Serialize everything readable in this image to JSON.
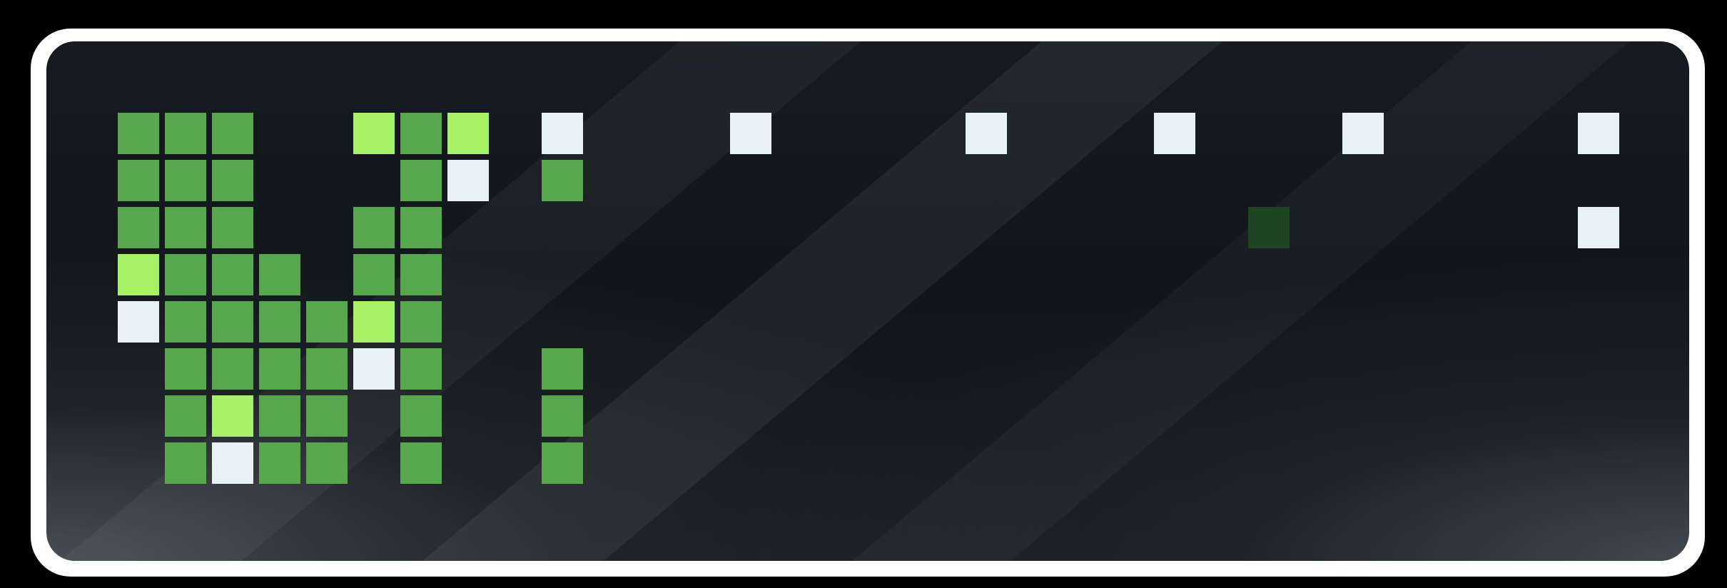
{
  "grid": {
    "columns": 32,
    "rows": 8,
    "colors": {
      "green": "#57a84c",
      "lime": "#a6f264",
      "white": "#e8f1f4",
      "dark_green": "#1f4422"
    },
    "cells": [
      {
        "c": 0,
        "r": 0,
        "t": "green"
      },
      {
        "c": 1,
        "r": 0,
        "t": "green"
      },
      {
        "c": 2,
        "r": 0,
        "t": "green"
      },
      {
        "c": 5,
        "r": 0,
        "t": "lime"
      },
      {
        "c": 6,
        "r": 0,
        "t": "green"
      },
      {
        "c": 7,
        "r": 0,
        "t": "lime"
      },
      {
        "c": 9,
        "r": 0,
        "t": "white"
      },
      {
        "c": 13,
        "r": 0,
        "t": "white"
      },
      {
        "c": 18,
        "r": 0,
        "t": "white"
      },
      {
        "c": 22,
        "r": 0,
        "t": "white"
      },
      {
        "c": 26,
        "r": 0,
        "t": "white"
      },
      {
        "c": 31,
        "r": 0,
        "t": "white"
      },
      {
        "c": 0,
        "r": 1,
        "t": "green"
      },
      {
        "c": 1,
        "r": 1,
        "t": "green"
      },
      {
        "c": 2,
        "r": 1,
        "t": "green"
      },
      {
        "c": 6,
        "r": 1,
        "t": "green"
      },
      {
        "c": 7,
        "r": 1,
        "t": "white"
      },
      {
        "c": 9,
        "r": 1,
        "t": "green"
      },
      {
        "c": 0,
        "r": 2,
        "t": "green"
      },
      {
        "c": 1,
        "r": 2,
        "t": "green"
      },
      {
        "c": 2,
        "r": 2,
        "t": "green"
      },
      {
        "c": 5,
        "r": 2,
        "t": "green"
      },
      {
        "c": 6,
        "r": 2,
        "t": "green"
      },
      {
        "c": 24,
        "r": 2,
        "t": "dark_green"
      },
      {
        "c": 31,
        "r": 2,
        "t": "white"
      },
      {
        "c": 0,
        "r": 3,
        "t": "lime"
      },
      {
        "c": 1,
        "r": 3,
        "t": "green"
      },
      {
        "c": 2,
        "r": 3,
        "t": "green"
      },
      {
        "c": 3,
        "r": 3,
        "t": "green"
      },
      {
        "c": 5,
        "r": 3,
        "t": "green"
      },
      {
        "c": 6,
        "r": 3,
        "t": "green"
      },
      {
        "c": 0,
        "r": 4,
        "t": "white"
      },
      {
        "c": 1,
        "r": 4,
        "t": "green"
      },
      {
        "c": 2,
        "r": 4,
        "t": "green"
      },
      {
        "c": 3,
        "r": 4,
        "t": "green"
      },
      {
        "c": 4,
        "r": 4,
        "t": "green"
      },
      {
        "c": 5,
        "r": 4,
        "t": "lime"
      },
      {
        "c": 6,
        "r": 4,
        "t": "green"
      },
      {
        "c": 1,
        "r": 5,
        "t": "green"
      },
      {
        "c": 2,
        "r": 5,
        "t": "green"
      },
      {
        "c": 3,
        "r": 5,
        "t": "green"
      },
      {
        "c": 4,
        "r": 5,
        "t": "green"
      },
      {
        "c": 5,
        "r": 5,
        "t": "white"
      },
      {
        "c": 6,
        "r": 5,
        "t": "green"
      },
      {
        "c": 9,
        "r": 5,
        "t": "green"
      },
      {
        "c": 1,
        "r": 6,
        "t": "green"
      },
      {
        "c": 2,
        "r": 6,
        "t": "lime"
      },
      {
        "c": 3,
        "r": 6,
        "t": "green"
      },
      {
        "c": 4,
        "r": 6,
        "t": "green"
      },
      {
        "c": 6,
        "r": 6,
        "t": "green"
      },
      {
        "c": 9,
        "r": 6,
        "t": "green"
      },
      {
        "c": 1,
        "r": 7,
        "t": "green"
      },
      {
        "c": 2,
        "r": 7,
        "t": "white"
      },
      {
        "c": 3,
        "r": 7,
        "t": "green"
      },
      {
        "c": 4,
        "r": 7,
        "t": "green"
      },
      {
        "c": 6,
        "r": 7,
        "t": "green"
      },
      {
        "c": 9,
        "r": 7,
        "t": "green"
      }
    ]
  }
}
